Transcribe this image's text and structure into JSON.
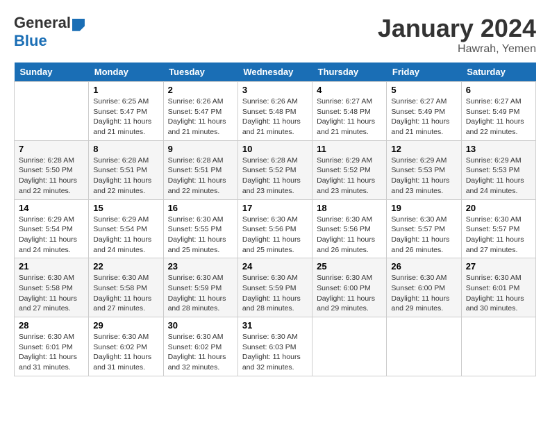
{
  "header": {
    "logo_general": "General",
    "logo_blue": "Blue",
    "month_year": "January 2024",
    "location": "Hawrah, Yemen"
  },
  "days_of_week": [
    "Sunday",
    "Monday",
    "Tuesday",
    "Wednesday",
    "Thursday",
    "Friday",
    "Saturday"
  ],
  "weeks": [
    [
      {
        "day": "",
        "info": ""
      },
      {
        "day": "1",
        "info": "Sunrise: 6:25 AM\nSunset: 5:47 PM\nDaylight: 11 hours\nand 21 minutes."
      },
      {
        "day": "2",
        "info": "Sunrise: 6:26 AM\nSunset: 5:47 PM\nDaylight: 11 hours\nand 21 minutes."
      },
      {
        "day": "3",
        "info": "Sunrise: 6:26 AM\nSunset: 5:48 PM\nDaylight: 11 hours\nand 21 minutes."
      },
      {
        "day": "4",
        "info": "Sunrise: 6:27 AM\nSunset: 5:48 PM\nDaylight: 11 hours\nand 21 minutes."
      },
      {
        "day": "5",
        "info": "Sunrise: 6:27 AM\nSunset: 5:49 PM\nDaylight: 11 hours\nand 21 minutes."
      },
      {
        "day": "6",
        "info": "Sunrise: 6:27 AM\nSunset: 5:49 PM\nDaylight: 11 hours\nand 22 minutes."
      }
    ],
    [
      {
        "day": "7",
        "info": "Sunrise: 6:28 AM\nSunset: 5:50 PM\nDaylight: 11 hours\nand 22 minutes."
      },
      {
        "day": "8",
        "info": "Sunrise: 6:28 AM\nSunset: 5:51 PM\nDaylight: 11 hours\nand 22 minutes."
      },
      {
        "day": "9",
        "info": "Sunrise: 6:28 AM\nSunset: 5:51 PM\nDaylight: 11 hours\nand 22 minutes."
      },
      {
        "day": "10",
        "info": "Sunrise: 6:28 AM\nSunset: 5:52 PM\nDaylight: 11 hours\nand 23 minutes."
      },
      {
        "day": "11",
        "info": "Sunrise: 6:29 AM\nSunset: 5:52 PM\nDaylight: 11 hours\nand 23 minutes."
      },
      {
        "day": "12",
        "info": "Sunrise: 6:29 AM\nSunset: 5:53 PM\nDaylight: 11 hours\nand 23 minutes."
      },
      {
        "day": "13",
        "info": "Sunrise: 6:29 AM\nSunset: 5:53 PM\nDaylight: 11 hours\nand 24 minutes."
      }
    ],
    [
      {
        "day": "14",
        "info": "Sunrise: 6:29 AM\nSunset: 5:54 PM\nDaylight: 11 hours\nand 24 minutes."
      },
      {
        "day": "15",
        "info": "Sunrise: 6:29 AM\nSunset: 5:54 PM\nDaylight: 11 hours\nand 24 minutes."
      },
      {
        "day": "16",
        "info": "Sunrise: 6:30 AM\nSunset: 5:55 PM\nDaylight: 11 hours\nand 25 minutes."
      },
      {
        "day": "17",
        "info": "Sunrise: 6:30 AM\nSunset: 5:56 PM\nDaylight: 11 hours\nand 25 minutes."
      },
      {
        "day": "18",
        "info": "Sunrise: 6:30 AM\nSunset: 5:56 PM\nDaylight: 11 hours\nand 26 minutes."
      },
      {
        "day": "19",
        "info": "Sunrise: 6:30 AM\nSunset: 5:57 PM\nDaylight: 11 hours\nand 26 minutes."
      },
      {
        "day": "20",
        "info": "Sunrise: 6:30 AM\nSunset: 5:57 PM\nDaylight: 11 hours\nand 27 minutes."
      }
    ],
    [
      {
        "day": "21",
        "info": "Sunrise: 6:30 AM\nSunset: 5:58 PM\nDaylight: 11 hours\nand 27 minutes."
      },
      {
        "day": "22",
        "info": "Sunrise: 6:30 AM\nSunset: 5:58 PM\nDaylight: 11 hours\nand 27 minutes."
      },
      {
        "day": "23",
        "info": "Sunrise: 6:30 AM\nSunset: 5:59 PM\nDaylight: 11 hours\nand 28 minutes."
      },
      {
        "day": "24",
        "info": "Sunrise: 6:30 AM\nSunset: 5:59 PM\nDaylight: 11 hours\nand 28 minutes."
      },
      {
        "day": "25",
        "info": "Sunrise: 6:30 AM\nSunset: 6:00 PM\nDaylight: 11 hours\nand 29 minutes."
      },
      {
        "day": "26",
        "info": "Sunrise: 6:30 AM\nSunset: 6:00 PM\nDaylight: 11 hours\nand 29 minutes."
      },
      {
        "day": "27",
        "info": "Sunrise: 6:30 AM\nSunset: 6:01 PM\nDaylight: 11 hours\nand 30 minutes."
      }
    ],
    [
      {
        "day": "28",
        "info": "Sunrise: 6:30 AM\nSunset: 6:01 PM\nDaylight: 11 hours\nand 31 minutes."
      },
      {
        "day": "29",
        "info": "Sunrise: 6:30 AM\nSunset: 6:02 PM\nDaylight: 11 hours\nand 31 minutes."
      },
      {
        "day": "30",
        "info": "Sunrise: 6:30 AM\nSunset: 6:02 PM\nDaylight: 11 hours\nand 32 minutes."
      },
      {
        "day": "31",
        "info": "Sunrise: 6:30 AM\nSunset: 6:03 PM\nDaylight: 11 hours\nand 32 minutes."
      },
      {
        "day": "",
        "info": ""
      },
      {
        "day": "",
        "info": ""
      },
      {
        "day": "",
        "info": ""
      }
    ]
  ]
}
